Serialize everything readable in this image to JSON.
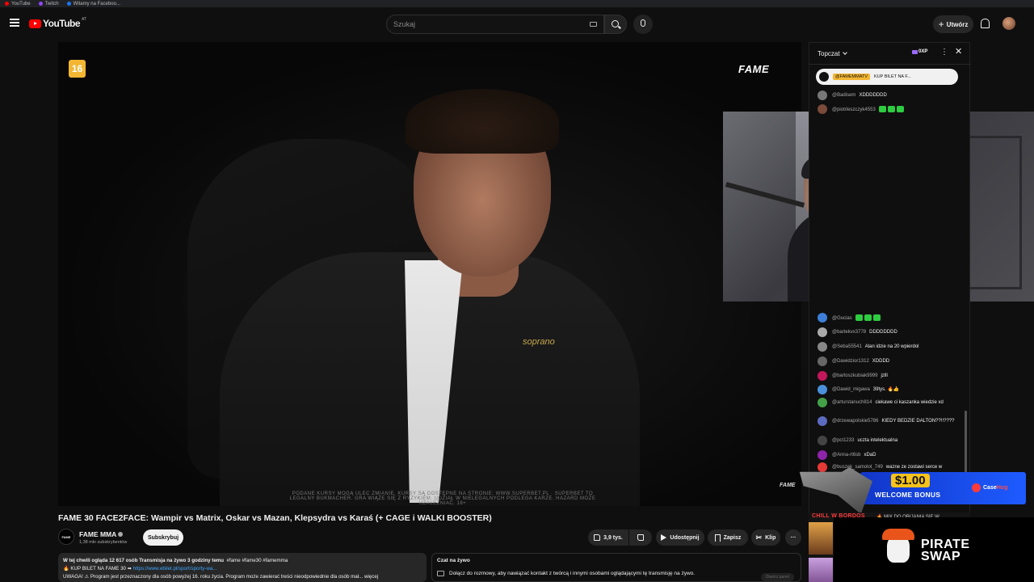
{
  "bookmarks": [
    {
      "label": "YouTube",
      "color": "#ff0000"
    },
    {
      "label": "Twitch",
      "color": "#9146ff"
    },
    {
      "label": "Witamy na Faceboo...",
      "color": "#1877f2"
    }
  ],
  "header": {
    "logo_text": "YouTube",
    "region": "AT",
    "search_placeholder": "Szukaj",
    "create_label": "Utwórz"
  },
  "video": {
    "age_rating": "16",
    "brand": "FAME",
    "brand_small": "FAME",
    "shirt_logo": "soprano",
    "caption": "PODANE KURSY MOGĄ ULEC ZMIANIE. KURSY SĄ DOSTĘPNE NA STRONIE: WWW.SUPERBET.PL · SUPERBET TO LEGALNY BUKMACHER. GRA WIĄŻE SIĘ Z RYZYKIEM. UDZIAŁ W NIELEGALNYCH PODLEGA KARZE. HAZARD MOŻE UZALEŻNIAĆ. 18+",
    "title": "FAME 30 FACE2FACE: Wampir vs Matrix, Oskar vs Mazan, Klepsydra vs Karaś (+ CAGE i WALKI BOOSTER)"
  },
  "channel": {
    "name": "FAME MMA",
    "avatar_text": "FAME",
    "subscribers": "1,38 mln subskrybentów",
    "subscribe_label": "Subskrybuj"
  },
  "actions": {
    "likes": "3,9 tys.",
    "share": "Udostępnij",
    "save": "Zapisz",
    "clip": "Klip",
    "more": "···"
  },
  "description": {
    "meta": "W tej chwili ogląda 12 617 osób  Transmisja na żywo 3 godziny temu",
    "tags": "#fame #fame30 #famemma",
    "line2_prefix": "🔥 KUP BILET NA FAME 30 ➡",
    "line2_link": "https://www.ebilet.pl/sport/sporty-wa...",
    "line3": "UWAGA! ⚠ Program jest przeznaczony dla osób powyżej 16. roku życia. Program może zawierać treści nieodpowiednie dla osób mał... więcej"
  },
  "live_chat_box": {
    "title": "Czat na żywo",
    "text": "Dołącz do rozmowy, aby nawiązać kontakt z twórcą i innymi osobami oglądającymi tę transmisję na żywo.",
    "button": "Otwórz panel"
  },
  "chat": {
    "title": "Topczat",
    "xp": "0XP",
    "pinned_author": "@FAMEMMATV",
    "pinned_text": "KUP BILET NA F...",
    "top_messages": [
      {
        "author": "@Badisem",
        "text": "XDDDDDDD",
        "color": "#777"
      },
      {
        "author": "@piotrleszczyk4553",
        "text": "",
        "emotes": 3,
        "color": "#7a4a3a"
      }
    ],
    "messages": [
      {
        "author": "@Gucias",
        "text": "",
        "emotes": 3,
        "color": "#3d7fd8"
      },
      {
        "author": "@bartekvx3778",
        "text": "DDDDDDDD",
        "color": "#aaa"
      },
      {
        "author": "@Seba55541",
        "text": "Alan idzie na 20 wpierdol",
        "color": "#888"
      },
      {
        "author": "@Dawidzior1312",
        "text": "XDDDD",
        "color": "#666"
      },
      {
        "author": "@bartoszkubiak9999",
        "text": "jzlll",
        "color": "#c2185b"
      },
      {
        "author": "@Dawid_migawa",
        "text": "39tys. 🔥👍",
        "color": "#4a90d9"
      },
      {
        "author": "@arturstanuch814",
        "text": "ciekawe ci kaszanka wiedzie xd",
        "color": "#43a047"
      },
      {
        "author": "@drzewapolskie5786",
        "text": "KIEDY BEDZIE DALTON??!!????",
        "color": "#5c6bc0"
      },
      {
        "author": "@pct1233",
        "text": "uczta intelektualna",
        "color": "#444"
      },
      {
        "author": "@Anna-rt6sb",
        "text": "xDaD",
        "color": "#8e24aa"
      },
      {
        "author": "@buszek_samolot_749",
        "text": "wazne ze zostawi serce w",
        "color": "#e53935"
      }
    ]
  },
  "promo": {
    "amount": "$1.00",
    "bonus": "WELCOME BONUS",
    "brand_a": "Case",
    "brand_b": "Hug"
  },
  "streams": {
    "label": "CHILL W BORDOS",
    "label2": "🔥 MIX DO OBIJANIA SIE W..."
  },
  "sponsor": {
    "line1": "PIRATE",
    "line2": "SWAP"
  }
}
